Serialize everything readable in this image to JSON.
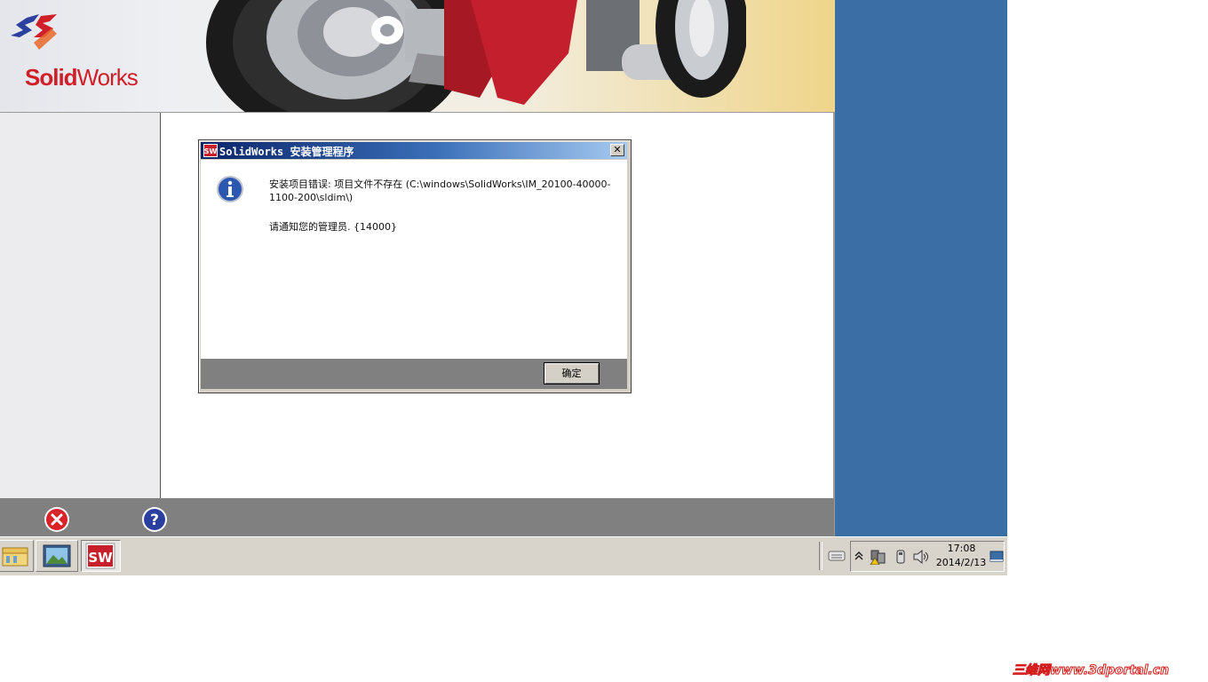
{
  "banner": {
    "logo_text_bold": "Solid",
    "logo_text_regular": "Works"
  },
  "toolbar": {
    "cancel_icon": "cancel-x-icon",
    "help_icon": "help-question-icon"
  },
  "dialog": {
    "title": "SolidWorks 安装管理程序",
    "close_glyph": "✕",
    "message": "安装项目错误: 项目文件不存在 (C:\\windows\\SolidWorks\\IM_20100-40000-1100-200\\sldim\\)",
    "message2": "请通知您的管理员. {14000}",
    "ok_label": "确定"
  },
  "taskbar": {
    "items": [
      "explorer-icon",
      "picture-viewer-icon",
      "solidworks-icon"
    ],
    "tray_icons": [
      "keyboard-icon",
      "show-hidden-icons-chevron",
      "network-warning-icon",
      "usb-icon",
      "volume-icon",
      "show-desktop-icon"
    ],
    "time": "17:08",
    "date": "2014/2/13"
  },
  "watermark": "三维网www.3dportal.cn",
  "colors": {
    "desktop": "#3a6ea5",
    "title_bar": "#0a246a",
    "logo_red": "#d11f2a"
  }
}
